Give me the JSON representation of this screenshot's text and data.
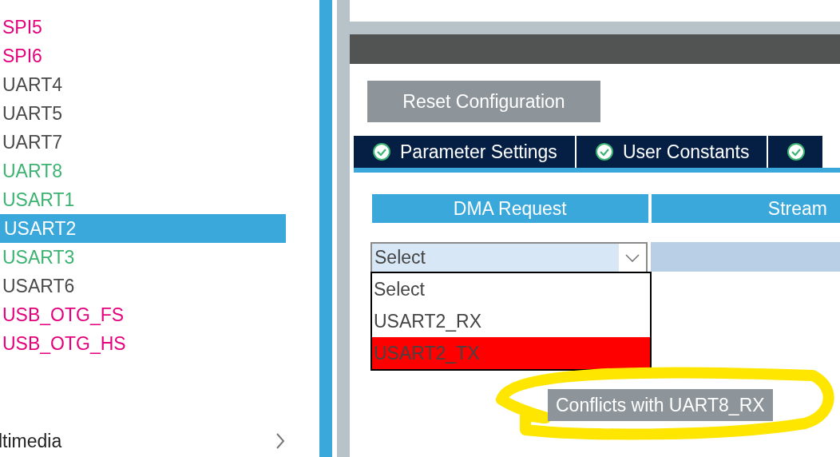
{
  "sidebar": {
    "items": [
      {
        "label": "SPI5",
        "color": "#e4007c",
        "selected": false
      },
      {
        "label": "SPI6",
        "color": "#e4007c",
        "selected": false
      },
      {
        "label": "UART4",
        "color": "#4a4a4a",
        "selected": false
      },
      {
        "label": "UART5",
        "color": "#4a4a4a",
        "selected": false
      },
      {
        "label": "UART7",
        "color": "#4a4a4a",
        "selected": false
      },
      {
        "label": "UART8",
        "color": "#3cb371",
        "selected": false
      },
      {
        "label": "USART1",
        "color": "#3cb371",
        "selected": false
      },
      {
        "label": "USART2",
        "selected": true
      },
      {
        "label": "USART3",
        "color": "#3cb371",
        "selected": false
      },
      {
        "label": "USART6",
        "color": "#4a4a4a",
        "selected": false
      },
      {
        "label": "USB_OTG_FS",
        "color": "#e4007c",
        "selected": false
      },
      {
        "label": "USB_OTG_HS",
        "color": "#e4007c",
        "selected": false
      }
    ],
    "category": {
      "label": "ltimedia",
      "expanded": false
    }
  },
  "reset_button": "Reset Configuration",
  "tabs": [
    {
      "label": "Parameter Settings",
      "valid": true
    },
    {
      "label": "User Constants",
      "valid": true
    },
    {
      "valid": true
    }
  ],
  "dma_table": {
    "columns": [
      "DMA Request",
      "Stream"
    ],
    "select": {
      "value": "Select",
      "open": true
    },
    "options": [
      {
        "label": "Select",
        "conflict": false
      },
      {
        "label": "USART2_RX",
        "conflict": false
      },
      {
        "label": "USART2_TX",
        "conflict": true
      }
    ],
    "tooltip": "Conflicts with UART8_RX"
  }
}
